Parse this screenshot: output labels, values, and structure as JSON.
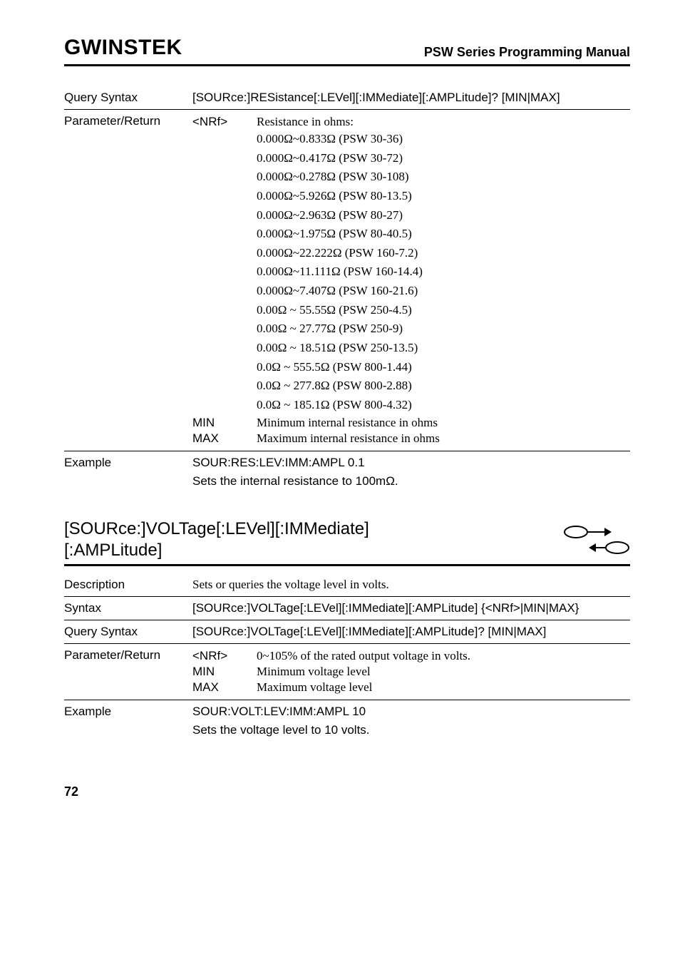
{
  "header": {
    "logo": "GWINSTEK",
    "doc_title": "PSW Series Programming Manual"
  },
  "section1": {
    "query_syntax": {
      "label": "Query Syntax",
      "value": "[SOURce:]RESistance[:LEVel][:IMMediate][:AMPLitude]? [MIN|MAX]"
    },
    "parameter_return": {
      "label": "Parameter/Return",
      "nrf": "<NRf>",
      "nrf_desc": "Resistance in ohms:",
      "resistance_values": [
        "0.000Ω~0.833Ω (PSW 30-36)",
        "0.000Ω~0.417Ω (PSW 30-72)",
        "0.000Ω~0.278Ω (PSW 30-108)",
        "0.000Ω~5.926Ω (PSW 80-13.5)",
        "0.000Ω~2.963Ω (PSW 80-27)",
        "0.000Ω~1.975Ω (PSW 80-40.5)",
        "0.000Ω~22.222Ω (PSW 160-7.2)",
        "0.000Ω~11.111Ω (PSW 160-14.4)",
        "0.000Ω~7.407Ω (PSW 160-21.6)",
        "0.00Ω ~ 55.55Ω (PSW 250-4.5)",
        "0.00Ω ~ 27.77Ω (PSW 250-9)",
        "0.00Ω ~ 18.51Ω (PSW 250-13.5)",
        "0.0Ω ~ 555.5Ω (PSW 800-1.44)",
        "0.0Ω ~ 277.8Ω (PSW 800-2.88)",
        "0.0Ω ~ 185.1Ω (PSW 800-4.32)"
      ],
      "min": {
        "key": "MIN",
        "val": "Minimum internal resistance in ohms"
      },
      "max": {
        "key": "MAX",
        "val": "Maximum internal resistance in ohms"
      }
    },
    "example": {
      "label": "Example",
      "cmd": "SOUR:RES:LEV:IMM:AMPL 0.1",
      "desc": "Sets the internal resistance to 100mΩ."
    }
  },
  "section2": {
    "title_line1": "[SOURce:]VOLTage[:LEVel][:IMMediate]",
    "title_line2": "[:AMPLitude]",
    "description": {
      "label": "Description",
      "value": "Sets or queries the voltage level in volts."
    },
    "syntax": {
      "label": "Syntax",
      "value": "[SOURce:]VOLTage[:LEVel][:IMMediate][:AMPLitude] {<NRf>|MIN|MAX}"
    },
    "query_syntax": {
      "label": "Query Syntax",
      "value": "[SOURce:]VOLTage[:LEVel][:IMMediate][:AMPLitude]? [MIN|MAX]"
    },
    "parameter_return": {
      "label": "Parameter/Return",
      "nrf": {
        "key": "<NRf>",
        "val": "0~105% of the rated output voltage in volts."
      },
      "min": {
        "key": "MIN",
        "val": "Minimum voltage level"
      },
      "max": {
        "key": "MAX",
        "val": "Maximum voltage level"
      }
    },
    "example": {
      "label": "Example",
      "cmd": "SOUR:VOLT:LEV:IMM:AMPL 10",
      "desc": "Sets the voltage level to 10 volts."
    }
  },
  "page_number": "72"
}
